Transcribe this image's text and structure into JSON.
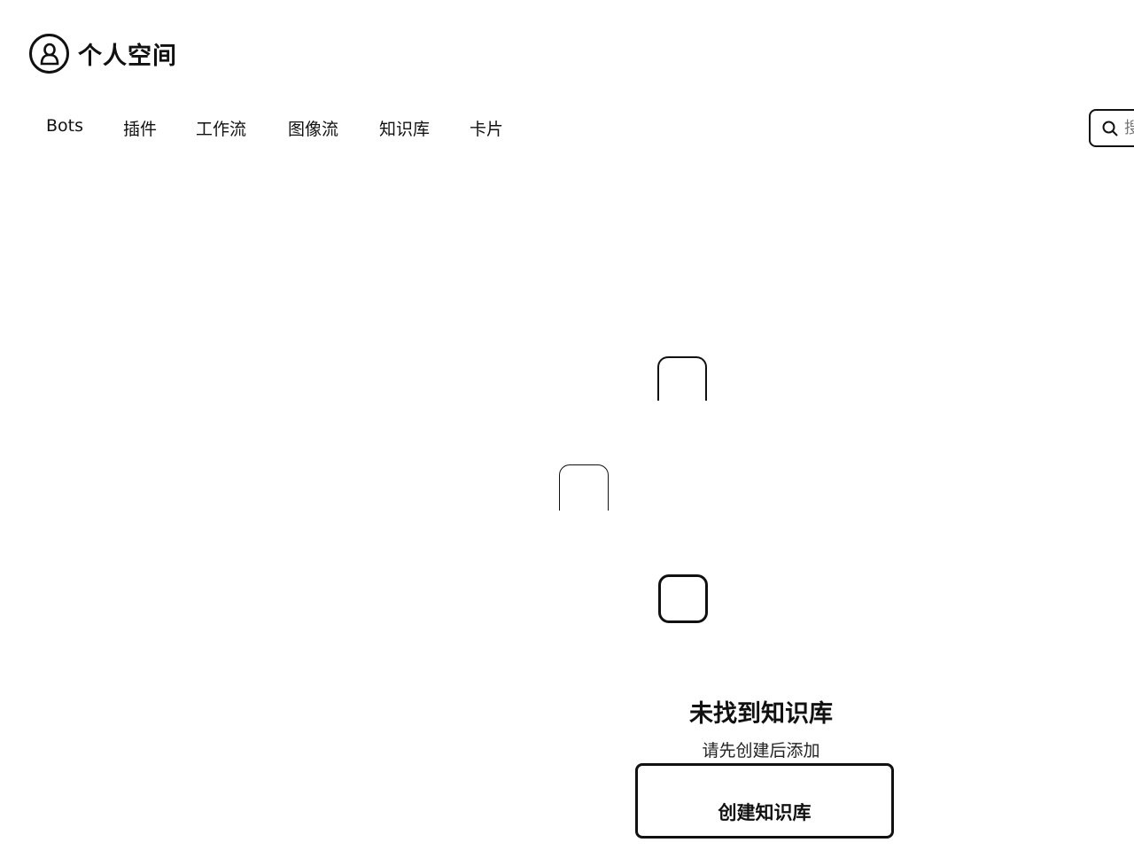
{
  "header": {
    "title": "个人空间",
    "icon": "user-avatar-icon"
  },
  "tabs": [
    {
      "label": "Bots"
    },
    {
      "label": "插件"
    },
    {
      "label": "工作流"
    },
    {
      "label": "图像流"
    },
    {
      "label": "知识库"
    },
    {
      "label": "卡片"
    }
  ],
  "search": {
    "icon": "search-icon",
    "placeholder": "搜"
  },
  "empty_state": {
    "title": "未找到知识库",
    "subtitle": "请先创建后添加",
    "button_label": "创建知识库"
  }
}
